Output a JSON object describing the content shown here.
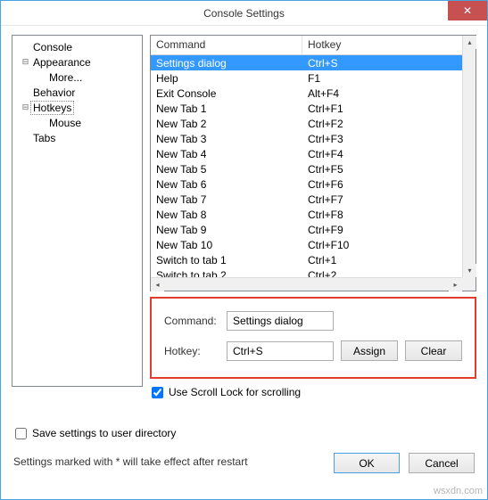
{
  "window": {
    "title": "Console Settings"
  },
  "tree": {
    "items": [
      {
        "label": "Console",
        "depth": 0,
        "twist": ""
      },
      {
        "label": "Appearance",
        "depth": 0,
        "twist": "−"
      },
      {
        "label": "More...",
        "depth": 1,
        "twist": ""
      },
      {
        "label": "Behavior",
        "depth": 0,
        "twist": ""
      },
      {
        "label": "Hotkeys",
        "depth": 0,
        "twist": "−",
        "selected": true
      },
      {
        "label": "Mouse",
        "depth": 1,
        "twist": ""
      },
      {
        "label": "Tabs",
        "depth": 0,
        "twist": ""
      }
    ]
  },
  "table": {
    "headers": {
      "command": "Command",
      "hotkey": "Hotkey"
    },
    "rows": [
      {
        "command": "Settings dialog",
        "hotkey": "Ctrl+S",
        "selected": true
      },
      {
        "command": "Help",
        "hotkey": "F1"
      },
      {
        "command": "Exit Console",
        "hotkey": "Alt+F4"
      },
      {
        "command": "New Tab 1",
        "hotkey": "Ctrl+F1"
      },
      {
        "command": "New Tab 2",
        "hotkey": "Ctrl+F2"
      },
      {
        "command": "New Tab 3",
        "hotkey": "Ctrl+F3"
      },
      {
        "command": "New Tab 4",
        "hotkey": "Ctrl+F4"
      },
      {
        "command": "New Tab 5",
        "hotkey": "Ctrl+F5"
      },
      {
        "command": "New Tab 6",
        "hotkey": "Ctrl+F6"
      },
      {
        "command": "New Tab 7",
        "hotkey": "Ctrl+F7"
      },
      {
        "command": "New Tab 8",
        "hotkey": "Ctrl+F8"
      },
      {
        "command": "New Tab 9",
        "hotkey": "Ctrl+F9"
      },
      {
        "command": "New Tab 10",
        "hotkey": "Ctrl+F10"
      },
      {
        "command": "Switch to tab 1",
        "hotkey": "Ctrl+1"
      },
      {
        "command": "Switch to tab 2",
        "hotkey": "Ctrl+2"
      }
    ]
  },
  "edit": {
    "command_label": "Command:",
    "command_value": "Settings dialog",
    "hotkey_label": "Hotkey:",
    "hotkey_value": "Ctrl+S",
    "assign": "Assign",
    "clear": "Clear"
  },
  "scroll_lock": {
    "label": "Use Scroll Lock for scrolling",
    "checked": true
  },
  "save_user_dir": {
    "label": "Save settings to user directory",
    "checked": false
  },
  "footer_note": "Settings marked with * will take effect after restart",
  "buttons": {
    "ok": "OK",
    "cancel": "Cancel"
  },
  "watermark": "wsxdn.com"
}
